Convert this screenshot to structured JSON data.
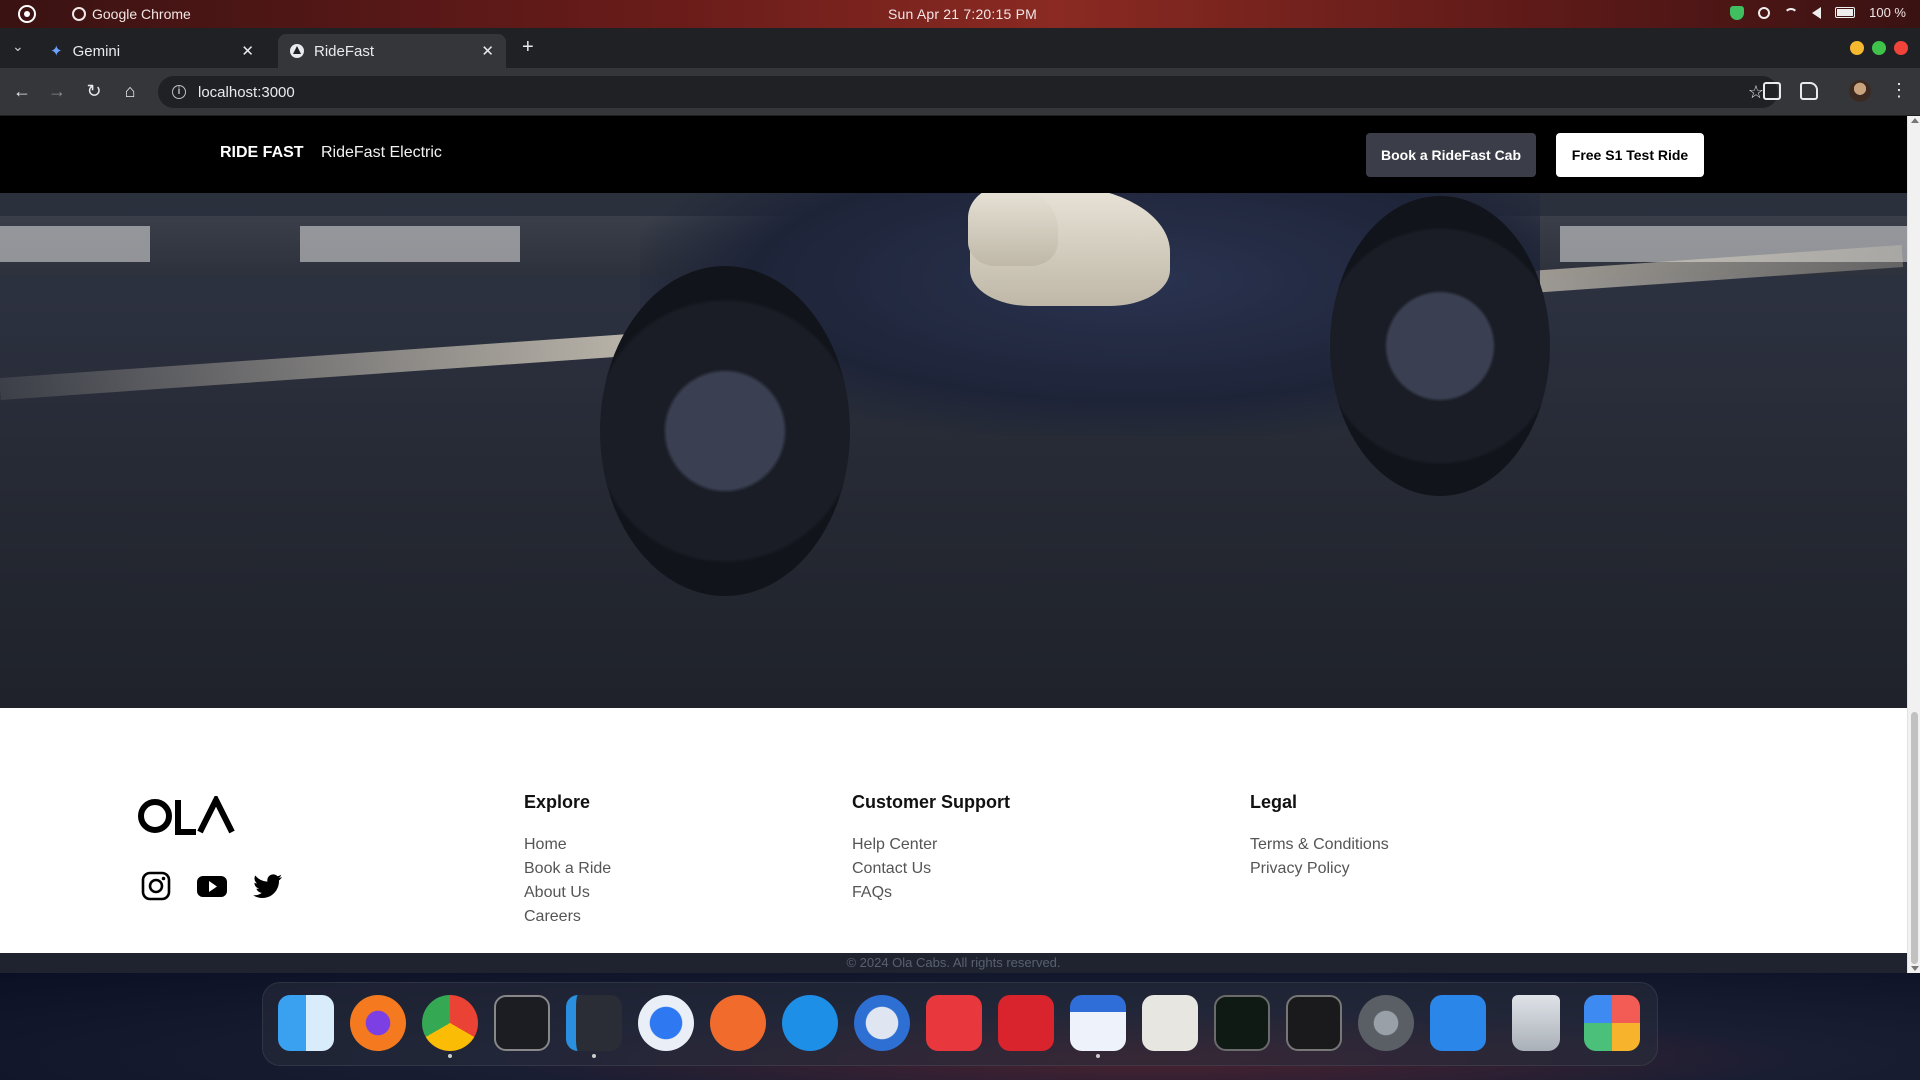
{
  "os": {
    "app_name": "Google Chrome",
    "clock": "Sun Apr 21   7:20:15 PM",
    "battery": "100 %"
  },
  "browser": {
    "tabs": [
      {
        "title": "Gemini",
        "icon": "gemini-sparkle-icon",
        "active": false
      },
      {
        "title": "RideFast",
        "icon": "ridefast-favicon",
        "active": true
      }
    ],
    "url": "localhost:3000",
    "window_controls": {
      "minimize": "#f5b82e",
      "maximize": "#3fc24a",
      "close": "#f0433a"
    }
  },
  "site": {
    "brand": "RIDE FAST",
    "brand_sub": "RideFast Electric",
    "cta_primary": "Book a RideFast Cab",
    "cta_secondary": "Free S1 Test Ride"
  },
  "footer": {
    "logo_text": "OLA",
    "socials": [
      "instagram-icon",
      "youtube-icon",
      "twitter-icon"
    ],
    "columns": [
      {
        "title": "Explore",
        "links": [
          "Home",
          "Book a Ride",
          "About Us",
          "Careers"
        ]
      },
      {
        "title": "Customer Support",
        "links": [
          "Help Center",
          "Contact Us",
          "FAQs"
        ]
      },
      {
        "title": "Legal",
        "links": [
          "Terms & Conditions",
          "Privacy Policy"
        ]
      }
    ],
    "copyright": "© 2024 Ola Cabs. All rights reserved."
  },
  "dock": {
    "apps": [
      "finder-icon",
      "firefox-icon",
      "chrome-icon",
      "terminal-icon",
      "vscode-icon",
      "app-store-a-icon",
      "postman-icon",
      "docker-icon",
      "thunderbird-icon",
      "anydesk-icon",
      "acrobat-icon",
      "text-editor-icon",
      "textedit-icon",
      "activity-monitor-icon",
      "system-monitor-icon",
      "system-settings-icon",
      "app-installer-icon",
      "trash-icon",
      "launchpad-icon"
    ]
  }
}
